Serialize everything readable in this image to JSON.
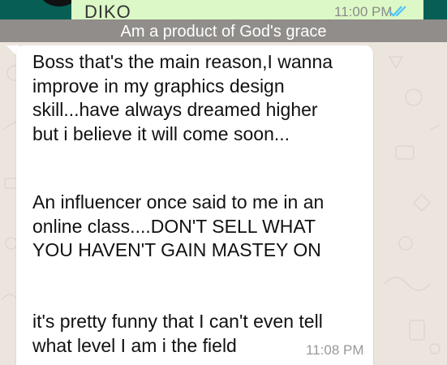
{
  "previous_message": {
    "sender": "DIKO",
    "time": "11:00 PM"
  },
  "caption": "Am a product of God's grace",
  "message": {
    "paragraphs": [
      "Boss that's the main reason,I wanna\nimprove in my graphics design\nskill...have always dreamed higher\nbut i believe it will come soon...",
      "An influencer once said to me in an\nonline class....DON'T SELL WHAT\nYOU HAVEN'T GAIN MASTEY ON",
      "it's pretty funny that I can't even tell\nwhat level I am i the field"
    ],
    "time": "11:08 PM"
  },
  "colors": {
    "header": "#075e54",
    "outgoing_bubble": "#dcf8c6",
    "incoming_bubble": "#ffffff",
    "wallpaper": "#ece5dd",
    "read_ticks": "#4fc3f7"
  },
  "icons": {
    "read_receipt": "double-check-icon"
  }
}
